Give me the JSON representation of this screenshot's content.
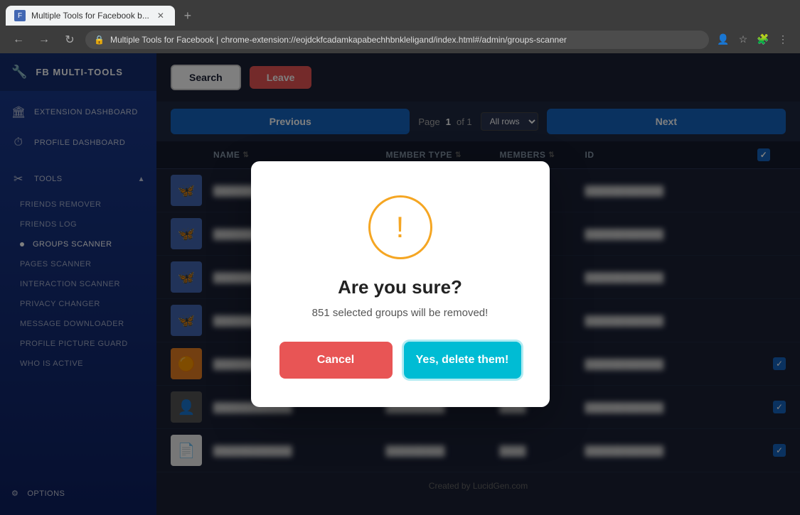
{
  "browser": {
    "tab_title": "Multiple Tools for Facebook b...",
    "address": "chrome-extension://eojdckfcadamkapabechhbnkleligand/index.html#/admin/groups-scanner",
    "address_display": "Multiple Tools for Facebook  |  chrome-extension://eojdckfcadamkapabechhbnkleligand/index.html#/admin/groups-scanner"
  },
  "sidebar": {
    "logo_text": "FB MULTI-TOOLS",
    "items": [
      {
        "label": "EXTENSION DASHBOARD",
        "icon": "🏛"
      },
      {
        "label": "PROFILE DASHBOARD",
        "icon": "⏱"
      }
    ],
    "tools_section": "TOOLS",
    "sub_items": [
      {
        "label": "FRIENDS REMOVER",
        "active": false
      },
      {
        "label": "FRIENDS LOG",
        "active": false
      },
      {
        "label": "GROUPS SCANNER",
        "active": true
      },
      {
        "label": "PAGES SCANNER",
        "active": false
      },
      {
        "label": "INTERACTION SCANNER",
        "active": false
      },
      {
        "label": "PRIVACY CHANGER",
        "active": false
      },
      {
        "label": "MESSAGE DOWNLOADER",
        "active": false
      },
      {
        "label": "PROFILE PICTURE GUARD",
        "active": false
      },
      {
        "label": "WHO IS ACTIVE",
        "active": false
      }
    ],
    "settings_label": "OPTIONS"
  },
  "toolbar": {
    "search_label": "Search",
    "leave_label": "Leave"
  },
  "pagination": {
    "prev_label": "Previous",
    "next_label": "Next",
    "page_label": "Page",
    "page_num": "1",
    "of_label": "of 1",
    "rows_label": "All rows"
  },
  "table": {
    "headers": [
      {
        "label": "NAME",
        "sortable": true
      },
      {
        "label": "MEMBER TYPE",
        "sortable": true
      },
      {
        "label": "MEMBERS",
        "sortable": true
      },
      {
        "label": "ID",
        "sortable": false
      }
    ],
    "rows": [
      {
        "avatar": "blue",
        "emoji": "🦋"
      },
      {
        "avatar": "blue",
        "emoji": "🦋"
      },
      {
        "avatar": "blue",
        "emoji": "🦋"
      },
      {
        "avatar": "blue",
        "emoji": "🦋"
      },
      {
        "avatar": "orange",
        "emoji": "🟠"
      },
      {
        "avatar": "gray",
        "emoji": "👤"
      },
      {
        "avatar": "paper",
        "emoji": "📄"
      }
    ],
    "footer": "Created by LucidGen.com"
  },
  "modal": {
    "title": "Are you sure?",
    "message_prefix": "851 selected groups will be removed!",
    "highlight_count": "851",
    "cancel_label": "Cancel",
    "confirm_label": "Yes, delete them!"
  },
  "watermark": "Lucid Gen"
}
